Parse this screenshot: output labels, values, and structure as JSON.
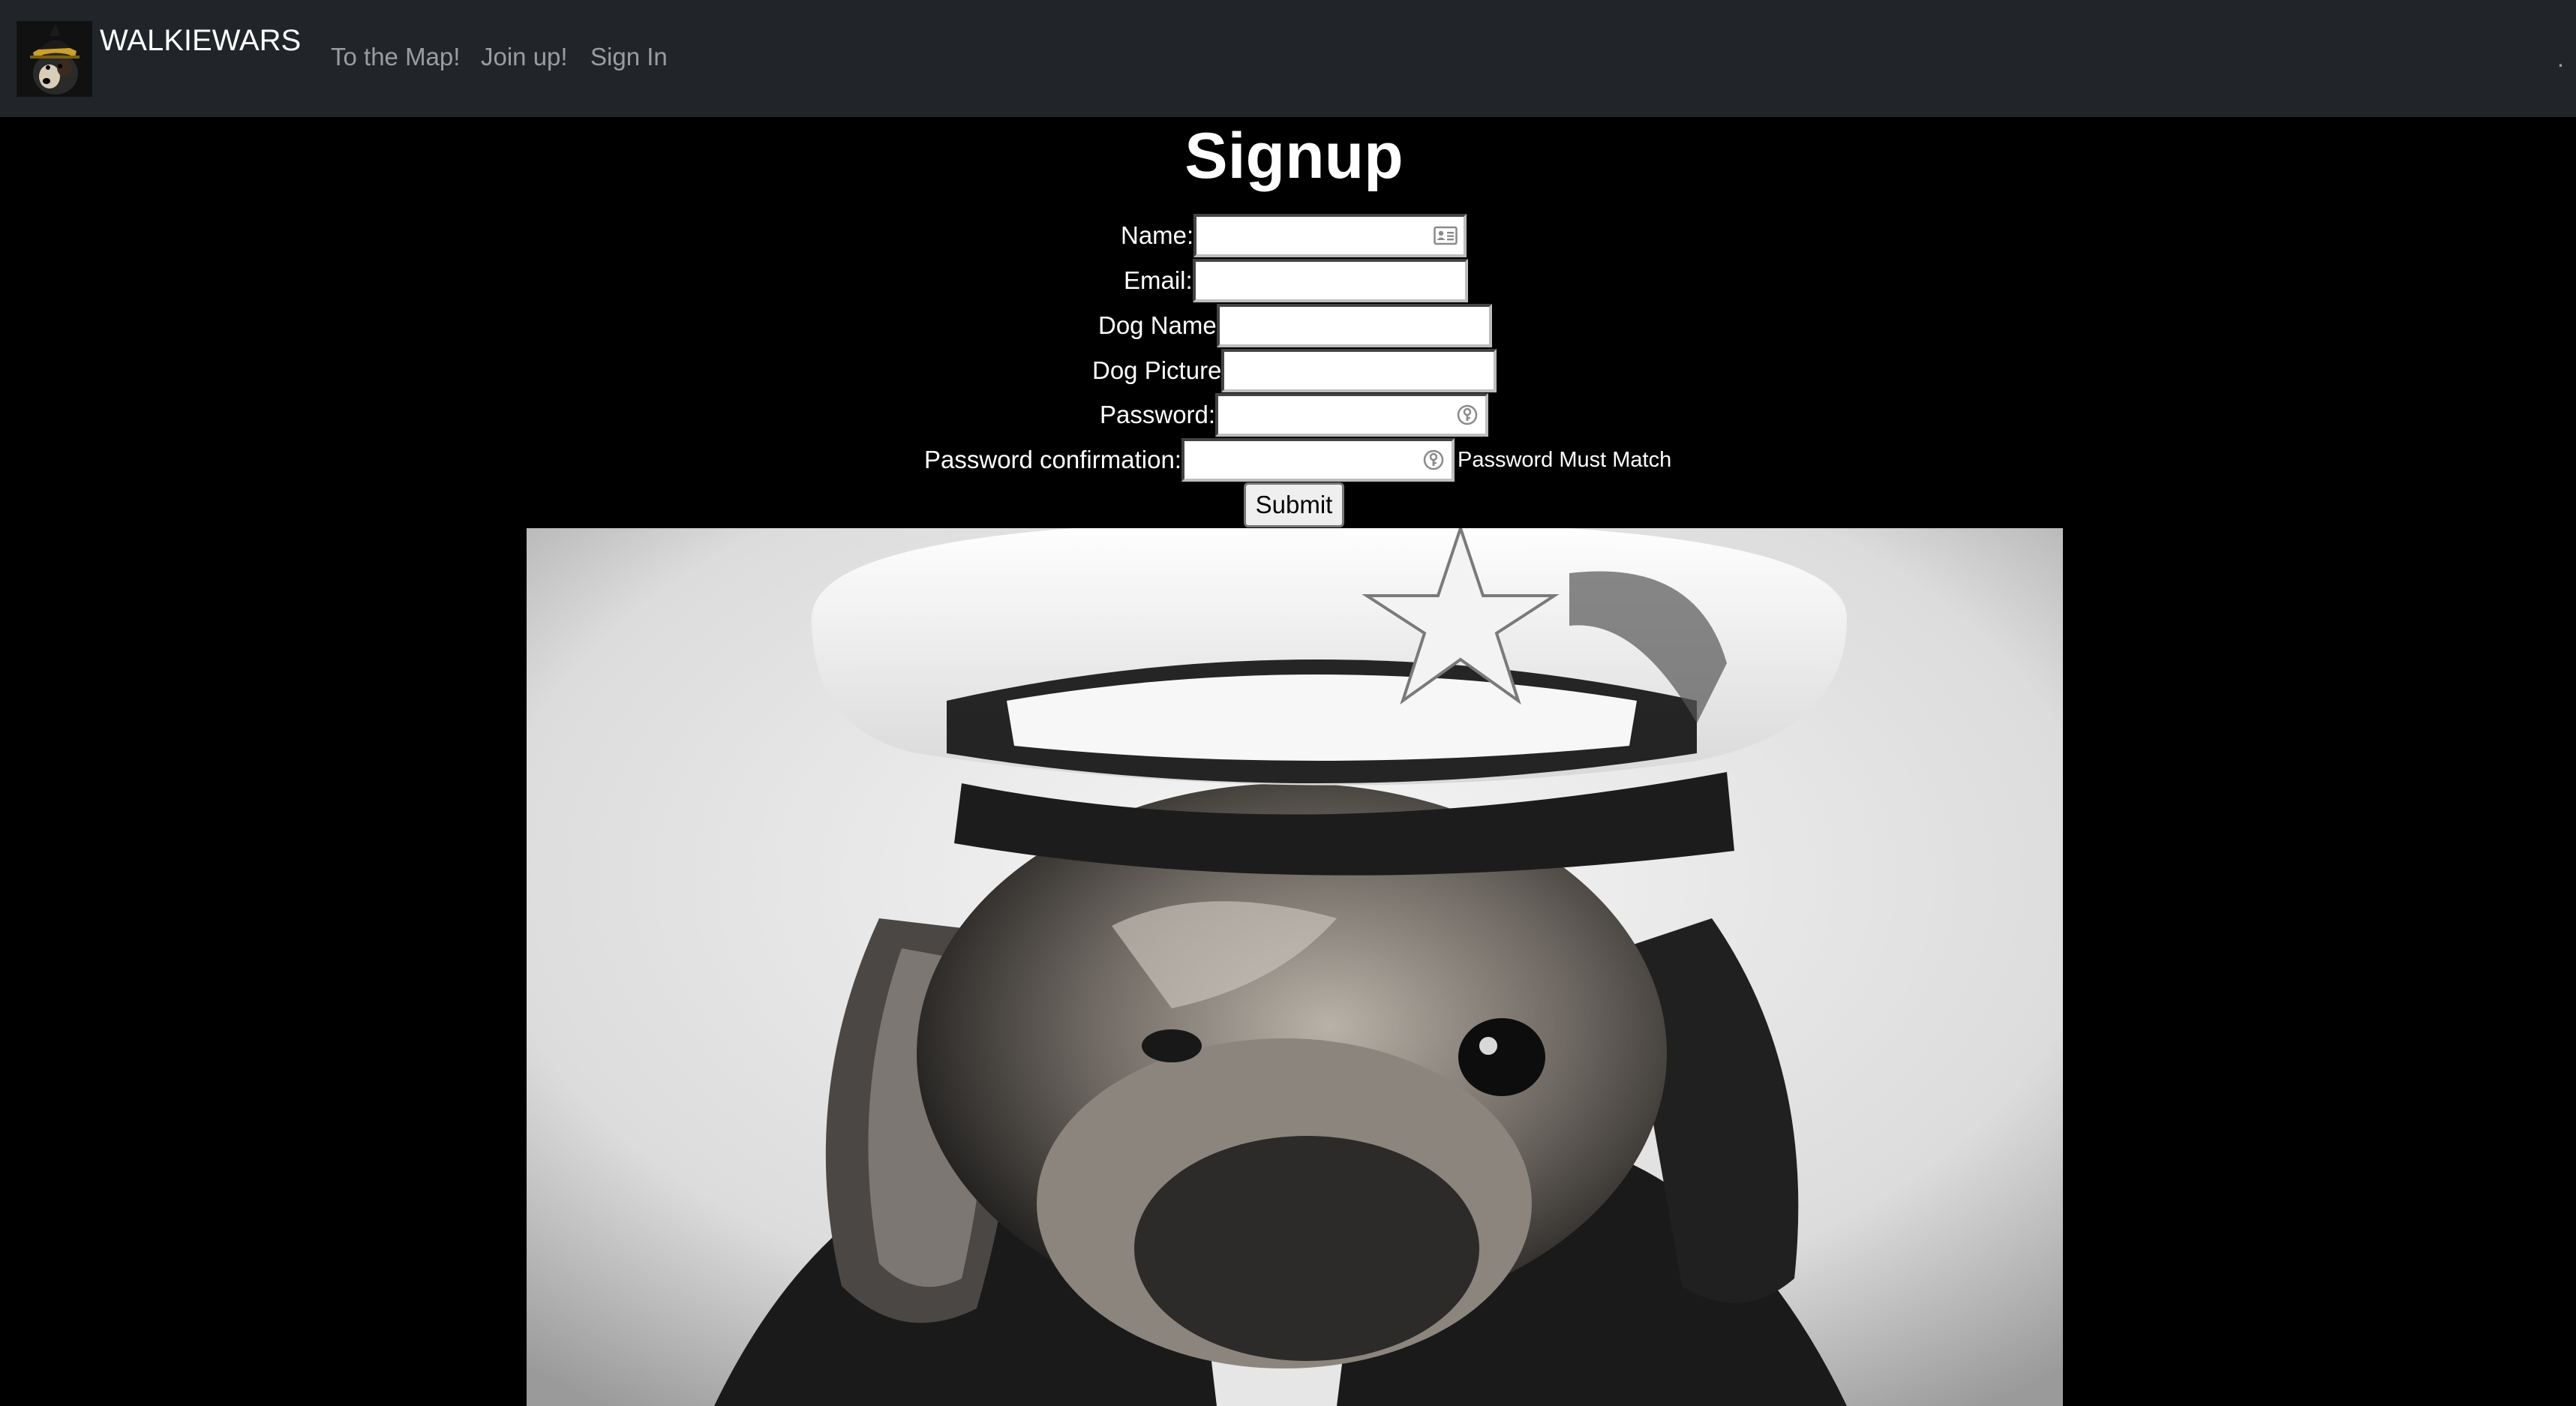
{
  "navbar": {
    "brand": "WALKIEWARS",
    "links": [
      {
        "label": "To the Map!",
        "icon": "none"
      },
      {
        "label": "Join up!",
        "icon": "none"
      },
      {
        "label": "Sign In",
        "icon": "none"
      }
    ],
    "right_glyph": ".",
    "background": "#212529",
    "link_color": "rgba(255,255,255,0.55)"
  },
  "page": {
    "title": "Signup",
    "background": "#000000"
  },
  "form": {
    "name": {
      "label": "Name:",
      "value": "",
      "icon": "contact-card-icon"
    },
    "email": {
      "label": "Email:",
      "value": ""
    },
    "dog_name": {
      "label": "Dog Name",
      "value": ""
    },
    "dog_picture": {
      "label": "Dog Picture",
      "value": ""
    },
    "password": {
      "label": "Password:",
      "value": "",
      "icon": "password-key-icon"
    },
    "password_confirmation": {
      "label": "Password confirmation:",
      "value": "",
      "icon": "password-key-icon",
      "hint": "Password Must Match"
    },
    "submit_label": "Submit"
  },
  "hero": {
    "subject": "black-and-white photo of a dog wearing a star cap",
    "icon": "dog-photo"
  }
}
